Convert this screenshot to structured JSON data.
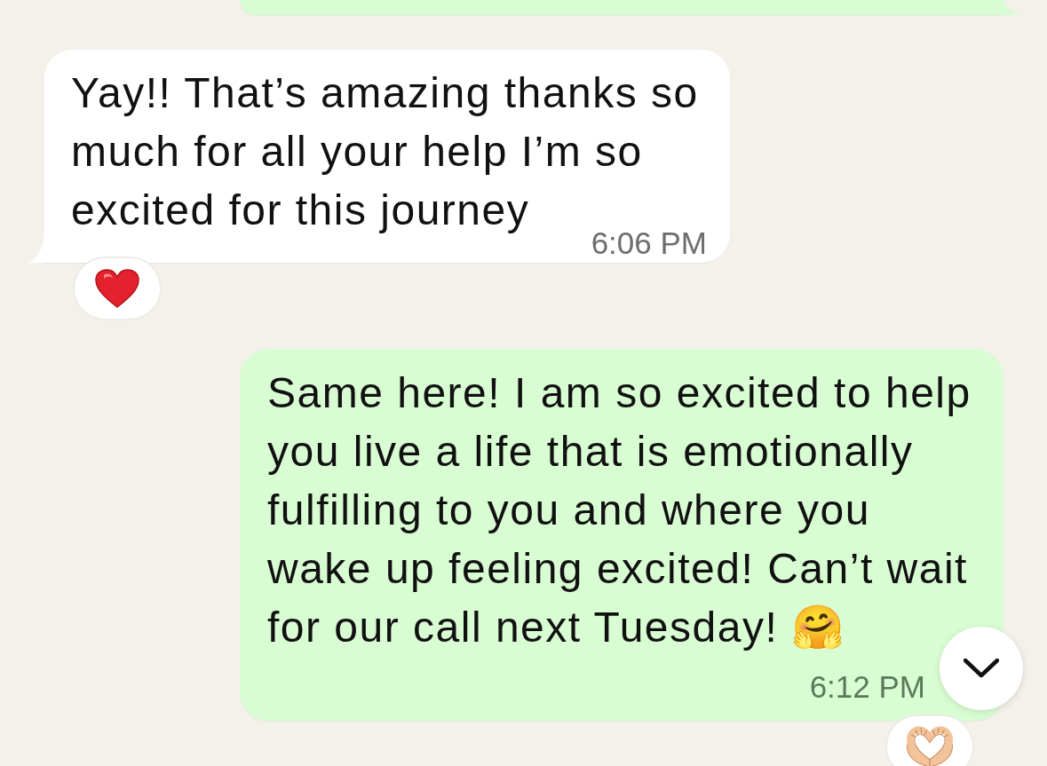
{
  "messages": [
    {
      "kind": "outgoing",
      "tail": true
    },
    {
      "kind": "incoming",
      "tail": true,
      "text": "Yay!! That’s amazing thanks so much for all your help I’m so excited for this journey",
      "time": "6:06 PM",
      "reaction": {
        "kind": "heart"
      }
    },
    {
      "kind": "outgoing",
      "tail": false,
      "text": "Same here! I am so excited to help you live a life that is emotionally fulfilling to you and where you wake up feeling excited! Can’t wait for our call next Tuesday! 🤗",
      "time": "6:12 PM",
      "reaction": {
        "kind": "heart-hands"
      }
    }
  ],
  "scroll_down_button": {
    "shown": true
  }
}
